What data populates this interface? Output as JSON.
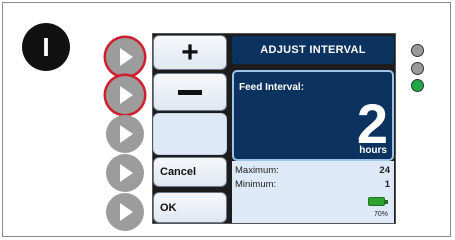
{
  "step": {
    "label": "I"
  },
  "screen": {
    "title": "ADJUST INTERVAL",
    "plus_label": "+",
    "cancel_label": "Cancel",
    "ok_label": "OK",
    "field_label": "Feed Interval:",
    "value": "2",
    "unit": "hours",
    "limits": [
      {
        "label": "Maximum:",
        "value": "24"
      },
      {
        "label": "Minimum:",
        "value": "1"
      }
    ],
    "battery": {
      "percent_text": "70%",
      "level": 0.7
    }
  },
  "side_buttons": [
    {
      "highlighted": true
    },
    {
      "highlighted": true
    },
    {
      "highlighted": false
    },
    {
      "highlighted": false
    },
    {
      "highlighted": false
    }
  ],
  "indicators": [
    {
      "color": "#9a9a9a"
    },
    {
      "color": "#9a9a9a"
    },
    {
      "color": "#1fa84a"
    }
  ],
  "colors": {
    "title_bar": "#0c3360",
    "highlight_ring": "#d01e2e",
    "panel_light": "#dde9f6",
    "battery": "#2fa12f"
  }
}
